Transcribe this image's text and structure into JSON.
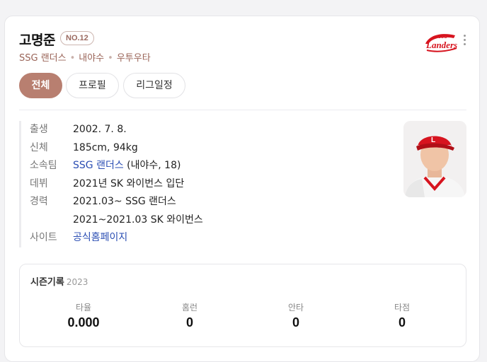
{
  "player": {
    "name": "고명준",
    "number": "NO.12",
    "team": "SSG 랜더스",
    "position": "내야수",
    "bats_throws": "우투우타"
  },
  "logo": {
    "text": "Landers",
    "small_text": "SSG",
    "color": "#d7141f"
  },
  "tabs": [
    {
      "label": "전체",
      "active": true
    },
    {
      "label": "프로필",
      "active": false
    },
    {
      "label": "리그일정",
      "active": false
    }
  ],
  "profile": {
    "birth": {
      "label": "출생",
      "value": "2002. 7. 8."
    },
    "body": {
      "label": "신체",
      "value": "185cm, 94kg"
    },
    "team": {
      "label": "소속팀",
      "link": "SSG 랜더스",
      "extra": "(내야수, 18)"
    },
    "debut": {
      "label": "데뷔",
      "value": "2021년 SK 와이번스 입단"
    },
    "career": {
      "label": "경력",
      "line1": "2021.03~ SSG 랜더스",
      "line2": "2021~2021.03 SK 와이번스"
    },
    "site": {
      "label": "사이트",
      "link": "공식홈페이지"
    }
  },
  "season": {
    "title": "시즌기록",
    "year": "2023",
    "stats": [
      {
        "label": "타율",
        "value": "0.000"
      },
      {
        "label": "홈런",
        "value": "0"
      },
      {
        "label": "안타",
        "value": "0"
      },
      {
        "label": "타점",
        "value": "0"
      }
    ]
  },
  "colors": {
    "accent": "#b87f70",
    "link": "#2a4db3",
    "team_red": "#d7141f"
  }
}
